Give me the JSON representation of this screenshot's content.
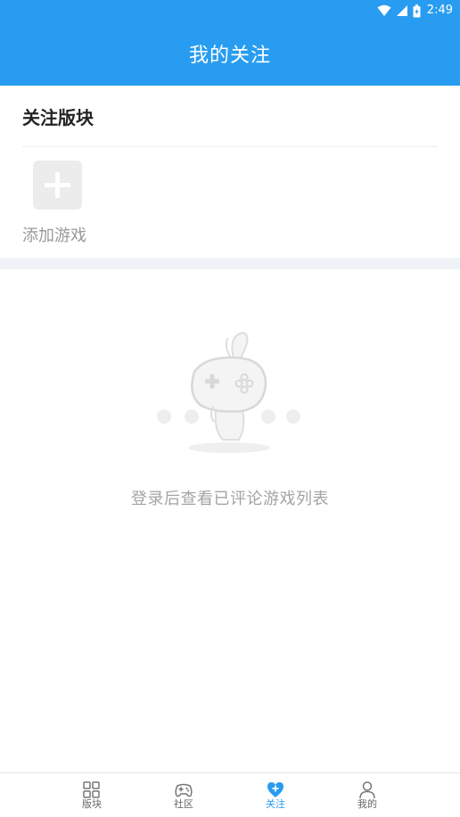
{
  "status_bar": {
    "time": "2:49",
    "icons": [
      "wifi-icon",
      "cell-signal-icon",
      "battery-icon"
    ]
  },
  "header": {
    "title": "我的关注"
  },
  "followed_section": {
    "title": "关注版块",
    "add_game_label": "添加游戏"
  },
  "empty_state": {
    "illustration": "bunny-gamepad-icon",
    "message": "登录后查看已评论游戏列表"
  },
  "bottom_nav": {
    "active_index": 2,
    "items": [
      {
        "label": "版块",
        "icon": "grid-icon"
      },
      {
        "label": "社区",
        "icon": "gamepad-icon"
      },
      {
        "label": "关注",
        "icon": "heart-plus-icon"
      },
      {
        "label": "我的",
        "icon": "user-icon"
      }
    ]
  },
  "colors": {
    "primary": "#289cf0",
    "background": "#ffffff",
    "divider_band": "#eff2f6",
    "muted_text": "#a4a4a4"
  }
}
